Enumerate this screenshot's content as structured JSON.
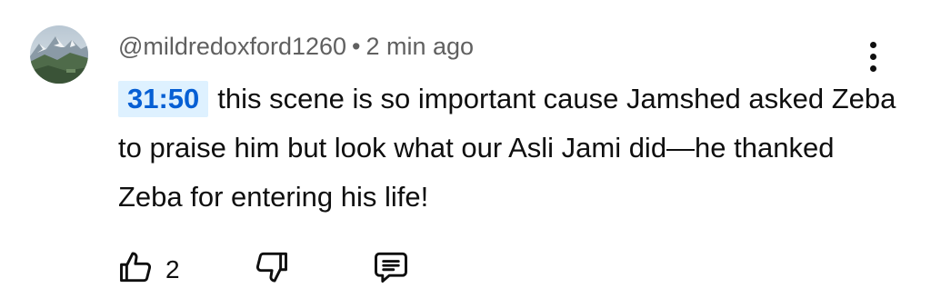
{
  "comment": {
    "author": "@mildredoxford1260",
    "separator": "•",
    "time_ago": "2 min ago",
    "timestamp_link": "31:50",
    "text": "this scene is so important cause Jamshed asked Zeba to praise him but look what our Asli Jami did—he thanked Zeba for entering his life!",
    "like_count": "2"
  },
  "icons": {
    "menu": "more-vert-icon",
    "like": "thumb-up-icon",
    "dislike": "thumb-down-icon",
    "reply": "comment-icon"
  },
  "colors": {
    "timestamp_text": "#065fd4",
    "timestamp_bg": "#def1ff",
    "meta_text": "#606060",
    "body_text": "#0f0f0f"
  }
}
